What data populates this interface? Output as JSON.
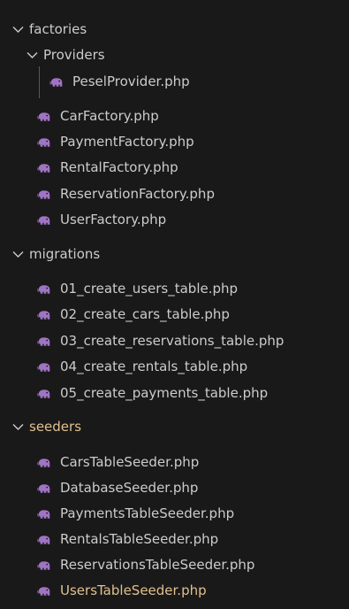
{
  "folders": {
    "factories": "factories",
    "providers": "Providers",
    "migrations": "migrations",
    "seeders": "seeders"
  },
  "files": {
    "pesel_provider": "PeselProvider.php",
    "car_factory": "CarFactory.php",
    "payment_factory": "PaymentFactory.php",
    "rental_factory": "RentalFactory.php",
    "reservation_factory": "ReservationFactory.php",
    "user_factory": "UserFactory.php",
    "m01": "01_create_users_table.php",
    "m02": "02_create_cars_table.php",
    "m03": "03_create_reservations_table.php",
    "m04": "04_create_rentals_table.php",
    "m05": "05_create_payments_table.php",
    "cars_seeder": "CarsTableSeeder.php",
    "database_seeder": "DatabaseSeeder.php",
    "payments_seeder": "PaymentsTableSeeder.php",
    "rentals_seeder": "RentalsTableSeeder.php",
    "reservations_seeder": "ReservationsTableSeeder.php",
    "users_seeder": "UsersTableSeeder.php"
  },
  "colors": {
    "background": "#191919",
    "text": "#cccccc",
    "modified_text": "#e2c08d",
    "php_icon": "#a074c4"
  },
  "icons": {
    "folder_expanded": "chevron-down-icon",
    "php_file": "php-elephant-icon"
  }
}
